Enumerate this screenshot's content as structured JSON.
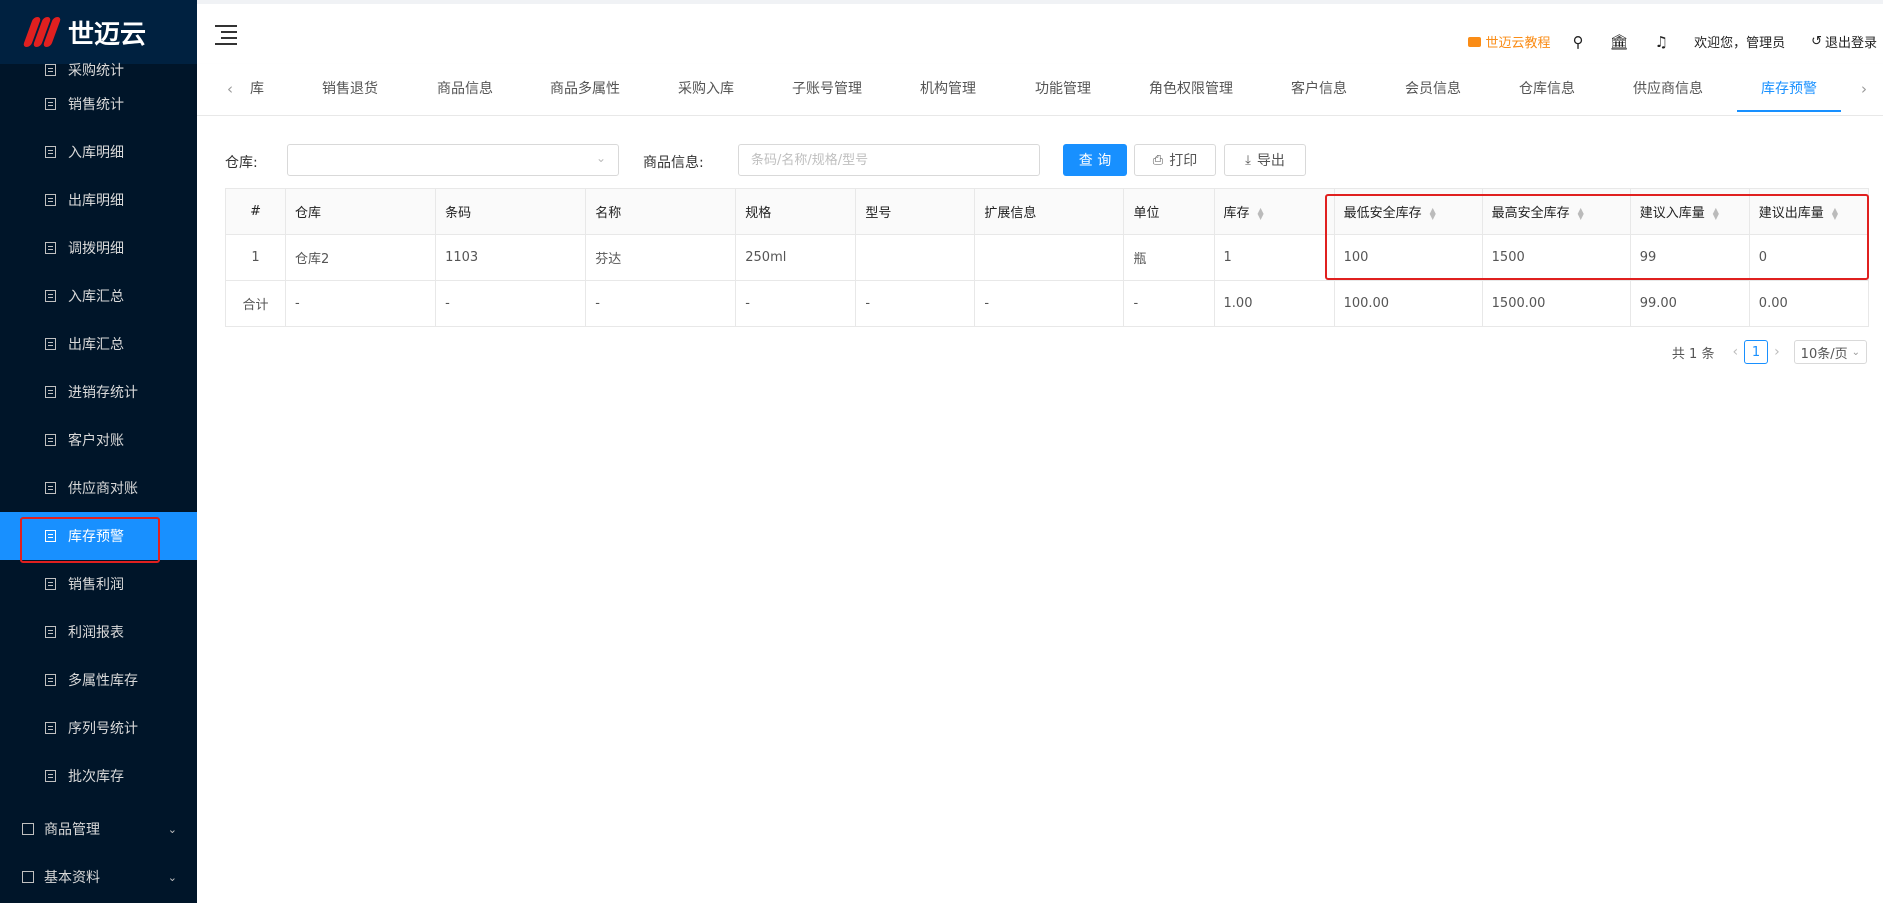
{
  "app": {
    "logo_text": "世迈云"
  },
  "sidebar": {
    "partial_item": "采购统计",
    "items": [
      {
        "label": "销售统计"
      },
      {
        "label": "入库明细"
      },
      {
        "label": "出库明细"
      },
      {
        "label": "调拨明细"
      },
      {
        "label": "入库汇总"
      },
      {
        "label": "出库汇总"
      },
      {
        "label": "进销存统计"
      },
      {
        "label": "客户对账"
      },
      {
        "label": "供应商对账"
      },
      {
        "label": "库存预警",
        "active": true
      },
      {
        "label": "销售利润"
      },
      {
        "label": "利润报表"
      },
      {
        "label": "多属性库存"
      },
      {
        "label": "序列号统计"
      },
      {
        "label": "批次库存"
      }
    ],
    "groups": [
      {
        "label": "商品管理"
      },
      {
        "label": "基本资料"
      }
    ],
    "active_color": "#1890ff",
    "highlight_color": "#e0201f"
  },
  "header": {
    "tutorial": "世迈云教程",
    "welcome": "欢迎您，管理员",
    "logout": "退出登录"
  },
  "tabs": {
    "items": [
      "库",
      "销售退货",
      "商品信息",
      "商品多属性",
      "采购入库",
      "子账号管理",
      "机构管理",
      "功能管理",
      "角色权限管理",
      "客户信息",
      "会员信息",
      "仓库信息",
      "供应商信息",
      "库存预警"
    ],
    "active": "库存预警"
  },
  "filters": {
    "warehouse_label": "仓库:",
    "warehouse_value": "",
    "goods_label": "商品信息:",
    "goods_placeholder": "条码/名称/规格/型号",
    "query_label": "查 询",
    "print_label": "打印",
    "export_label": "导出"
  },
  "table": {
    "columns": [
      "#",
      "仓库",
      "条码",
      "名称",
      "规格",
      "型号",
      "扩展信息",
      "单位",
      "库存",
      "最低安全库存",
      "最高安全库存",
      "建议入库量",
      "建议出库量"
    ],
    "rows": [
      [
        "1",
        "仓库2",
        "1103",
        "芬达",
        "250ml",
        "",
        "",
        "瓶",
        "1",
        "100",
        "1500",
        "99",
        "0"
      ]
    ],
    "total_row": [
      "合计",
      "-",
      "-",
      "-",
      "-",
      "-",
      "-",
      "-",
      "1.00",
      "100.00",
      "1500.00",
      "99.00",
      "0.00"
    ]
  },
  "pagination": {
    "total": "共 1 条",
    "current": "1",
    "page_size": "10条/页"
  }
}
